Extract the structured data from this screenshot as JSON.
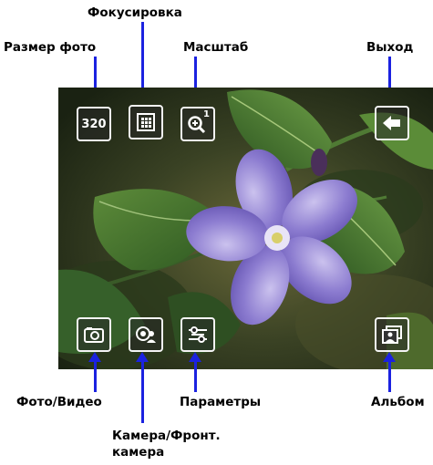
{
  "labels": {
    "focus": "Фокусировка",
    "photo_size": "Размер фото",
    "zoom": "Масштаб",
    "exit": "Выход",
    "photo_video": "Фото/Видео",
    "params": "Параметры",
    "album": "Альбом",
    "camera_front_line1": "Камера/Фронт.",
    "camera_front_line2": "камера"
  },
  "buttons": {
    "size_value": "320",
    "zoom_level": "1"
  },
  "colors": {
    "pointer": "#1b22e0",
    "button_border": "#f4f4f4"
  },
  "icons": [
    "size-button",
    "focus-icon",
    "zoom-icon",
    "exit-arrow-icon",
    "camera-mode-icon",
    "switch-camera-icon",
    "settings-icon",
    "album-icon"
  ]
}
